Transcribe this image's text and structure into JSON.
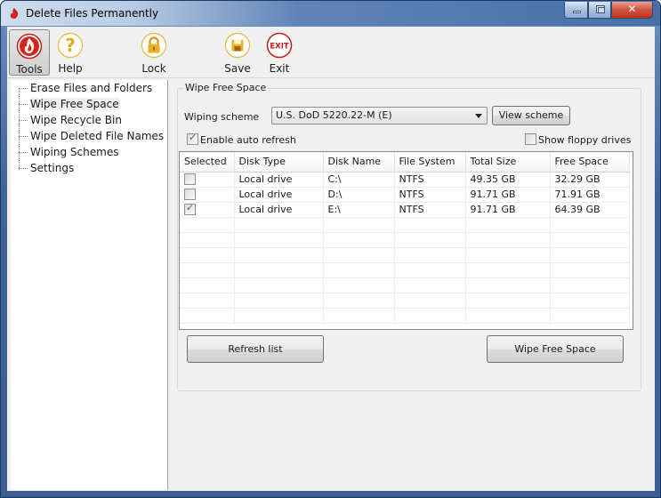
{
  "window": {
    "title": "Delete Files Permanently",
    "controls": {
      "minimize": "minimize",
      "maximize": "maximize",
      "close": "close"
    }
  },
  "toolbar": {
    "items": [
      {
        "label": "Tools",
        "icon": "flame-icon",
        "active": true
      },
      {
        "label": "Help",
        "icon": "question-icon"
      },
      {
        "label": "Lock",
        "icon": "lock-icon"
      },
      {
        "label": "Save",
        "icon": "floppy-disk-icon"
      },
      {
        "label": "Exit",
        "icon": "exit-icon",
        "glyph": "EXIT"
      }
    ]
  },
  "tree": {
    "items": [
      {
        "label": "Erase Files and Folders"
      },
      {
        "label": "Wipe Free Space",
        "selected": true
      },
      {
        "label": "Wipe Recycle Bin"
      },
      {
        "label": "Wipe Deleted File Names"
      },
      {
        "label": "Wiping Schemes"
      },
      {
        "label": "Settings"
      }
    ]
  },
  "panel": {
    "title": "Wipe Free Space",
    "wiping_scheme_label": "Wiping scheme",
    "wiping_scheme_value": "U.S. DoD 5220.22-M (E)",
    "view_scheme_label": "View scheme",
    "auto_refresh_label": "Enable auto refresh",
    "auto_refresh_checked": true,
    "show_floppy_label": "Show floppy drives",
    "show_floppy_checked": false,
    "table": {
      "columns": [
        "Selected",
        "Disk Type",
        "Disk Name",
        "File System",
        "Total Size",
        "Free Space"
      ],
      "rows": [
        {
          "selected": false,
          "disk_type": "Local drive",
          "disk_name": "C:\\",
          "file_system": "NTFS",
          "total_size": "49.35 GB",
          "free_space": "32.29 GB"
        },
        {
          "selected": false,
          "disk_type": "Local drive",
          "disk_name": "D:\\",
          "file_system": "NTFS",
          "total_size": "91.71 GB",
          "free_space": "71.91 GB"
        },
        {
          "selected": true,
          "disk_type": "Local drive",
          "disk_name": "E:\\",
          "file_system": "NTFS",
          "total_size": "91.71 GB",
          "free_space": "64.39 GB"
        }
      ]
    },
    "refresh_label": "Refresh list",
    "wipe_label": "Wipe Free Space"
  },
  "colors": {
    "accent_red": "#d01f1f",
    "accent_gold": "#e6a817",
    "title_blue": "#4670a7"
  }
}
